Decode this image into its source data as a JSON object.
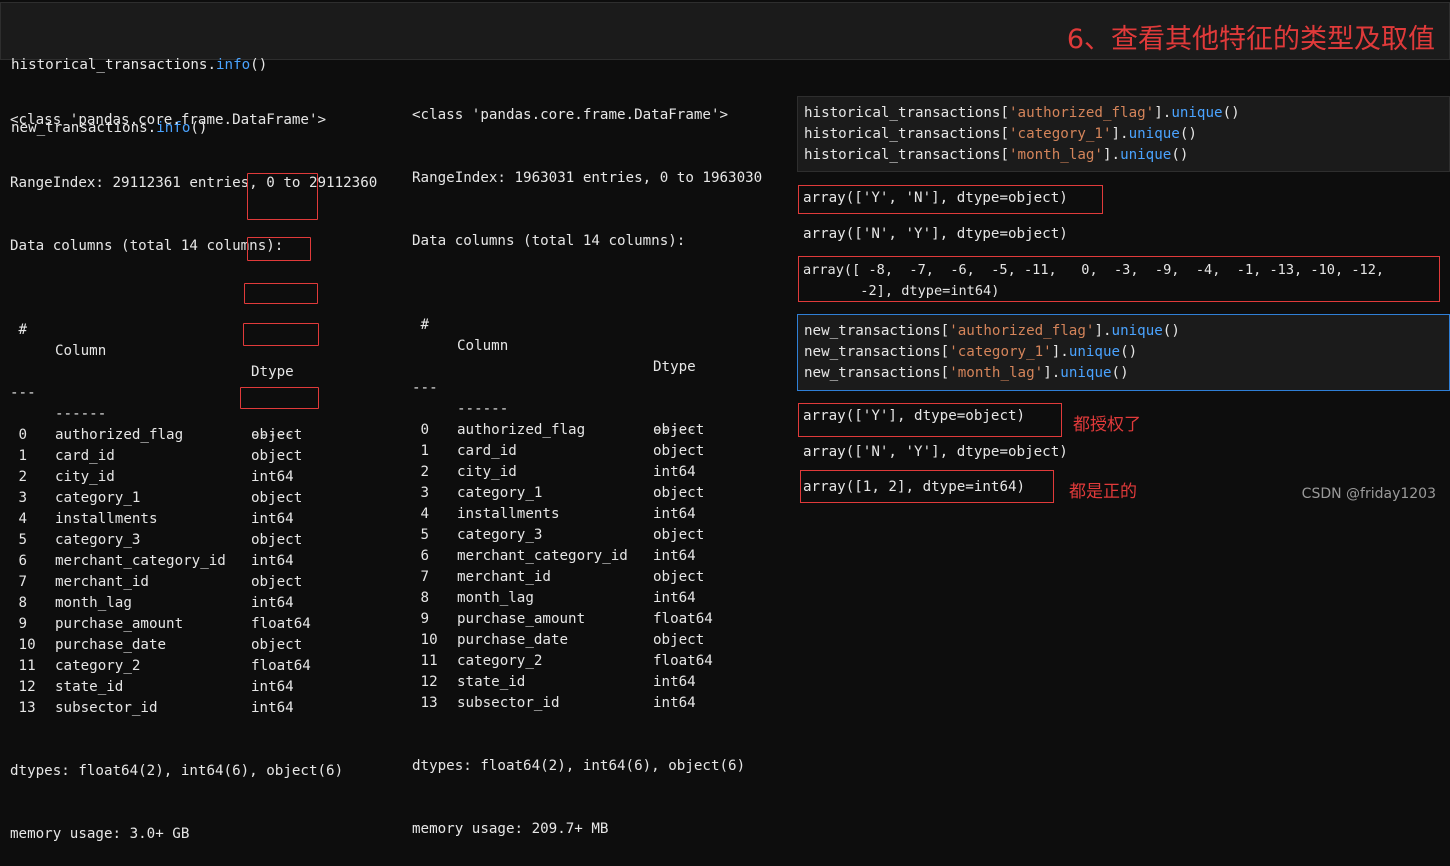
{
  "top_cell": {
    "line1_var": "historical_transactions.",
    "line1_fn": "info",
    "line1_paren": "()",
    "line2_var": "new_transactions.",
    "line2_fn": "info",
    "line2_paren": "()",
    "annotation": "6、查看其他特征的类型及取值"
  },
  "output_left": {
    "class_line": "<class 'pandas.core.frame.DataFrame'>",
    "range_line": "RangeIndex: 29112361 entries, 0 to 29112360",
    "data_cols_line": "Data columns (total 14 columns):",
    "header": {
      "idx": " #",
      "col": "Column",
      "dtype": "Dtype"
    },
    "sep": {
      "idx": "---",
      "col": "------",
      "dtype": "-----"
    },
    "rows": [
      {
        "idx": " 0",
        "col": "authorized_flag",
        "dtype": "object"
      },
      {
        "idx": " 1",
        "col": "card_id",
        "dtype": "object"
      },
      {
        "idx": " 2",
        "col": "city_id",
        "dtype": "int64"
      },
      {
        "idx": " 3",
        "col": "category_1",
        "dtype": "object"
      },
      {
        "idx": " 4",
        "col": "installments",
        "dtype": "int64"
      },
      {
        "idx": " 5",
        "col": "category_3",
        "dtype": "object"
      },
      {
        "idx": " 6",
        "col": "merchant_category_id",
        "dtype": "int64"
      },
      {
        "idx": " 7",
        "col": "merchant_id",
        "dtype": "object"
      },
      {
        "idx": " 8",
        "col": "month_lag",
        "dtype": "int64"
      },
      {
        "idx": " 9",
        "col": "purchase_amount",
        "dtype": "float64"
      },
      {
        "idx": " 10",
        "col": "purchase_date",
        "dtype": "object"
      },
      {
        "idx": " 11",
        "col": "category_2",
        "dtype": "float64"
      },
      {
        "idx": " 12",
        "col": "state_id",
        "dtype": "int64"
      },
      {
        "idx": " 13",
        "col": "subsector_id",
        "dtype": "int64"
      }
    ],
    "dtypes_line": "dtypes: float64(2), int64(6), object(6)",
    "memory_line": "memory usage: 3.0+ GB"
  },
  "output_right": {
    "class_line": "<class 'pandas.core.frame.DataFrame'>",
    "range_line": "RangeIndex: 1963031 entries, 0 to 1963030",
    "data_cols_line": "Data columns (total 14 columns):",
    "header": {
      "idx": " #",
      "col": "Column",
      "dtype": "Dtype"
    },
    "sep": {
      "idx": "---",
      "col": "------",
      "dtype": "-----"
    },
    "rows": [
      {
        "idx": " 0",
        "col": "authorized_flag",
        "dtype": "object"
      },
      {
        "idx": " 1",
        "col": "card_id",
        "dtype": "object"
      },
      {
        "idx": " 2",
        "col": "city_id",
        "dtype": "int64"
      },
      {
        "idx": " 3",
        "col": "category_1",
        "dtype": "object"
      },
      {
        "idx": " 4",
        "col": "installments",
        "dtype": "int64"
      },
      {
        "idx": " 5",
        "col": "category_3",
        "dtype": "object"
      },
      {
        "idx": " 6",
        "col": "merchant_category_id",
        "dtype": "int64"
      },
      {
        "idx": " 7",
        "col": "merchant_id",
        "dtype": "object"
      },
      {
        "idx": " 8",
        "col": "month_lag",
        "dtype": "int64"
      },
      {
        "idx": " 9",
        "col": "purchase_amount",
        "dtype": "float64"
      },
      {
        "idx": " 10",
        "col": "purchase_date",
        "dtype": "object"
      },
      {
        "idx": " 11",
        "col": "category_2",
        "dtype": "float64"
      },
      {
        "idx": " 12",
        "col": "state_id",
        "dtype": "int64"
      },
      {
        "idx": " 13",
        "col": "subsector_id",
        "dtype": "int64"
      }
    ],
    "dtypes_line": "dtypes: float64(2), int64(6), object(6)",
    "memory_line": "memory usage: 209.7+ MB"
  },
  "hist_cell": {
    "var": "historical_transactions[",
    "close": "].",
    "fn": "unique",
    "paren": "()",
    "keys": [
      "'authorized_flag'",
      "'category_1'",
      "'month_lag'"
    ]
  },
  "hist_out": {
    "auth": "array(['Y', 'N'], dtype=object)",
    "cat1": "array(['N', 'Y'], dtype=object)",
    "lag_line1": "array([ -8,  -7,  -6,  -5, -11,   0,  -3,  -9,  -4,  -1, -13, -10, -12,",
    "lag_line2": "       -2], dtype=int64)"
  },
  "new_cell": {
    "var": "new_transactions[",
    "close": "].",
    "fn": "unique",
    "paren": "()",
    "keys": [
      "'authorized_flag'",
      "'category_1'",
      "'month_lag'"
    ]
  },
  "new_out": {
    "auth": "array(['Y'], dtype=object)",
    "auth_note": "都授权了",
    "cat1": "array(['N', 'Y'], dtype=object)",
    "lag": "array([1, 2], dtype=int64)",
    "lag_note": "都是正的"
  },
  "watermark": "CSDN @friday1203",
  "colors": {
    "accent_red": "#e03a3a",
    "fn_blue": "#4aa3ff",
    "string_orange": "#d4845a",
    "cell_bg": "#1b1b1b",
    "active_border": "#2f7fd6"
  }
}
